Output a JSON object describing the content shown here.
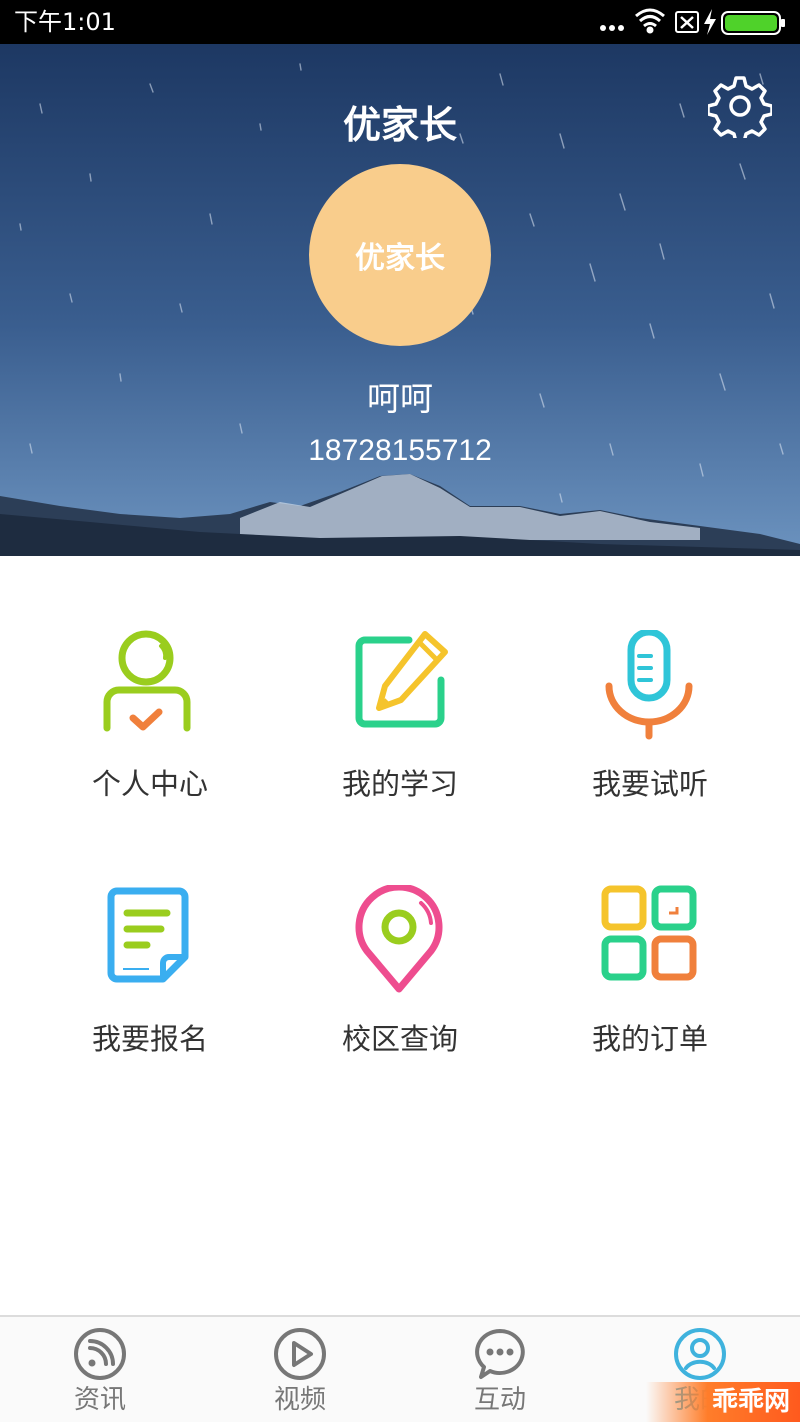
{
  "status_bar": {
    "time": "下午1:01"
  },
  "header": {
    "title": "优家长",
    "avatar_text": "优家长",
    "user_name": "呵呵",
    "phone": "18728155712"
  },
  "grid": [
    {
      "label": "个人中心",
      "icon": "person-icon"
    },
    {
      "label": "我的学习",
      "icon": "pencil-note-icon"
    },
    {
      "label": "我要试听",
      "icon": "microphone-icon"
    },
    {
      "label": "我要报名",
      "icon": "document-icon"
    },
    {
      "label": "校区查询",
      "icon": "location-pin-icon"
    },
    {
      "label": "我的订单",
      "icon": "grid-order-icon"
    }
  ],
  "bottom_nav": [
    {
      "label": "资讯",
      "icon": "rss-icon"
    },
    {
      "label": "视频",
      "icon": "play-icon"
    },
    {
      "label": "互动",
      "icon": "chat-bubble-icon"
    },
    {
      "label": "我的",
      "icon": "user-circle-icon",
      "active": true
    }
  ],
  "watermark": "乖乖网",
  "colors": {
    "avatar": "#f9cd8c",
    "active_nav": "#3fb2dd",
    "header_sky_top": "#1f3f6f",
    "header_sky_bottom": "#5d86b4"
  }
}
